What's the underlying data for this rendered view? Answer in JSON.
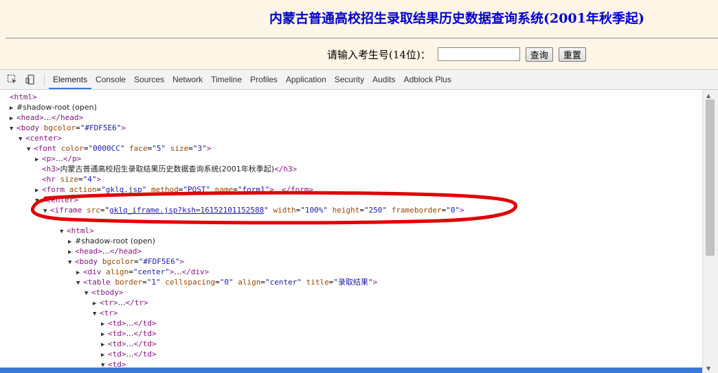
{
  "page": {
    "title": "内蒙古普通高校招生录取结果历史数据查询系统(2001年秋季起)",
    "query_label": "请输入考生号(14位)：",
    "input_value": "",
    "query_button": "查询",
    "reset_button": "重置"
  },
  "devtools": {
    "tabs": [
      "Elements",
      "Console",
      "Sources",
      "Network",
      "Timeline",
      "Profiles",
      "Application",
      "Security",
      "Audits",
      "Adblock Plus"
    ],
    "active_tab": "Elements"
  },
  "dom": {
    "html": "<html>",
    "shadow_root": "#shadow-root (open)",
    "head_open": "<head>",
    "head_ellipsis": "…",
    "head_close": "</head>",
    "body_open": "<body",
    "bgcolor_attr": " bgcolor",
    "bgcolor_val": "\"#FDF5E6\"",
    "gt": ">",
    "center_open": "<center>",
    "font_open": "<font",
    "color_attr": " color",
    "color_val": "\"0000CC\"",
    "face_attr": " face",
    "face_val": "\"5\"",
    "size_attr": " size",
    "size_val": "\"3\"",
    "p_open": "<p>",
    "p_close": "</p>",
    "h3_open": "<h3>",
    "h3_text": "内蒙古普通高校招生录取结果历史数据查询系统(2001年秋季起)",
    "h3_close": "</h3>",
    "hr_open": "<hr",
    "hr_size_val": "\"4\"",
    "form_open": "<form",
    "action_attr": " action",
    "action_val": "\"gklq.jsp\"",
    "method_attr": " method",
    "method_val": "\"POST\"",
    "name_attr": " name",
    "name_val": "\"form1\"",
    "form_close": "</form>",
    "iframe_open": "<iframe",
    "src_attr": " src",
    "src_val": "gklq_iframe.jsp?ksh=16152101152588",
    "width_attr": " width",
    "width_val": "\"100%\"",
    "height_attr": " height",
    "height_val": "\"250\"",
    "frameborder_attr": " frameborder",
    "frameborder_val": "\"0\"",
    "div_open": "<div",
    "align_attr": " align",
    "align_val": "\"center\"",
    "div_close": "</div>",
    "table_open": "<table",
    "border_attr": " border",
    "border_val": "\"1\"",
    "cellspacing_attr": " cellspacing",
    "cellspacing_val": "\"0\"",
    "title_attr": " title",
    "title_val": "\"录取结果\"",
    "tbody_open": "<tbody>",
    "tr_open": "<tr>",
    "tr_close": "</tr>",
    "td_open": "<td>",
    "td_close": "</td>"
  },
  "colors": {
    "page_bg": "#FDF5E6",
    "title_color": "#0000CC",
    "annotation_red": "#e00000",
    "selection_blue": "#3879d9"
  }
}
